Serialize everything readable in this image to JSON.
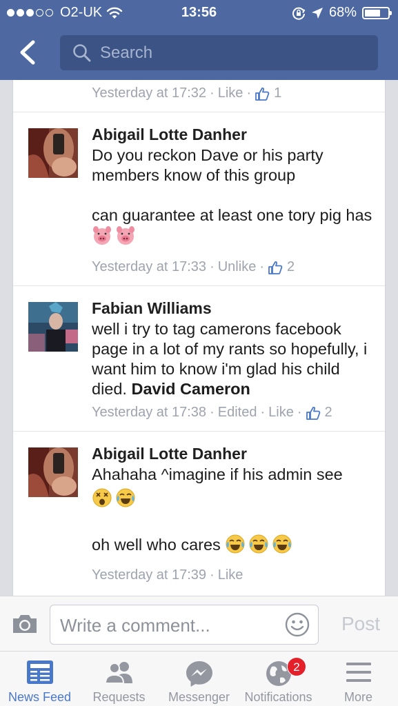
{
  "status_bar": {
    "carrier": "O2-UK",
    "time": "13:56",
    "battery_percent_label": "68%",
    "battery_level": 0.68
  },
  "search": {
    "placeholder": "Search"
  },
  "top_comment": {
    "timestamp": "Yesterday at 17:32",
    "action": "Like",
    "likes": "1"
  },
  "comments": [
    {
      "author": "Abigail Lotte Danher",
      "text_1": "Do you reckon Dave or his party members know of this group",
      "text_2": "can guarantee at least one tory pig has",
      "emojis": [
        "pig-face",
        "pig-face"
      ],
      "timestamp": "Yesterday at 17:33",
      "action": "Unlike",
      "likes": "2"
    },
    {
      "author": "Fabian Williams",
      "text": "well i try to tag camerons facebook page in a lot of my rants so hopefully, i want him to know i'm glad his child died.",
      "tag": "David Cameron",
      "timestamp": "Yesterday at 17:38",
      "edited": "Edited",
      "action": "Like",
      "likes": "2"
    },
    {
      "author": "Abigail Lotte Danher",
      "text_1": "Ahahaha ^imagine if his admin see",
      "emojis_1": [
        "dizzy-face",
        "tears-of-joy"
      ],
      "text_2": "oh well who cares",
      "emojis_2": [
        "tears-of-joy",
        "tears-of-joy",
        "tears-of-joy"
      ],
      "timestamp": "Yesterday at 17:39",
      "action": "Like"
    }
  ],
  "composer": {
    "placeholder": "Write a comment...",
    "post_label": "Post"
  },
  "tabs": [
    {
      "label": "News Feed",
      "icon": "news-feed-icon",
      "active": true
    },
    {
      "label": "Requests",
      "icon": "friends-icon"
    },
    {
      "label": "Messenger",
      "icon": "messenger-icon"
    },
    {
      "label": "Notifications",
      "icon": "globe-icon",
      "badge": "2"
    },
    {
      "label": "More",
      "icon": "menu-icon"
    }
  ],
  "colors": {
    "header": "#4e69a2",
    "search_field": "#3b5385",
    "like_blue": "#4a78c9",
    "badge_red": "#e4202b"
  }
}
